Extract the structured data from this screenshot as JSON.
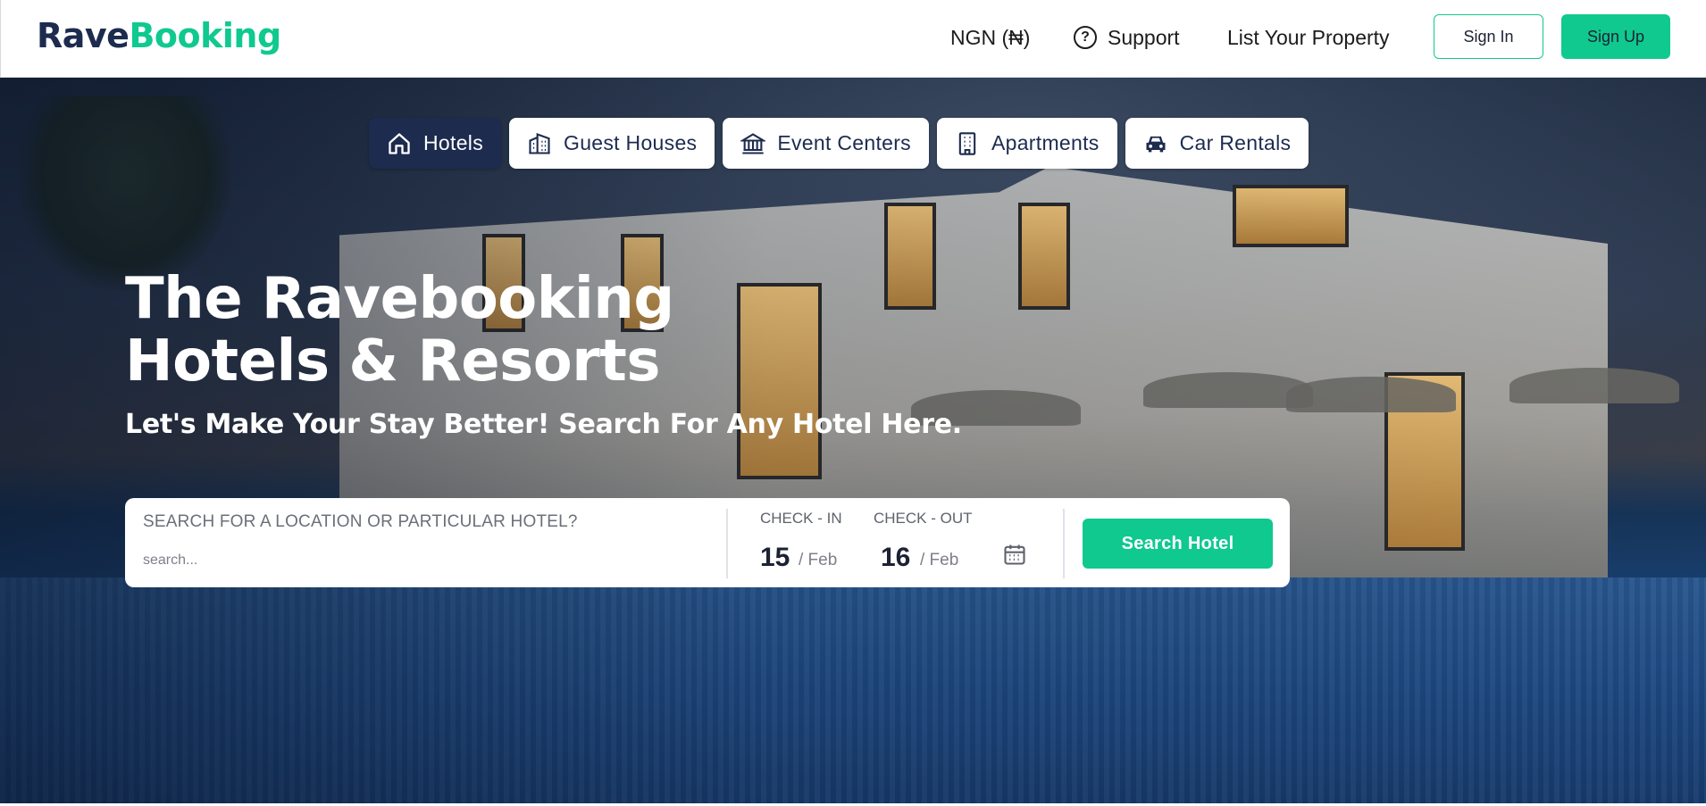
{
  "header": {
    "logo_part1": "Rave",
    "logo_part2": "Booking",
    "currency": "NGN (₦)",
    "support_label": "Support",
    "list_property_label": "List Your Property",
    "sign_in_label": "Sign In",
    "sign_up_label": "Sign Up"
  },
  "tabs": [
    {
      "label": "Hotels",
      "icon": "home-icon",
      "active": true
    },
    {
      "label": "Guest Houses",
      "icon": "building-icon",
      "active": false
    },
    {
      "label": "Event Centers",
      "icon": "bank-icon",
      "active": false
    },
    {
      "label": "Apartments",
      "icon": "apartment-icon",
      "active": false
    },
    {
      "label": "Car Rentals",
      "icon": "car-icon",
      "active": false
    }
  ],
  "hero": {
    "title_line1": "The Ravebooking",
    "title_line2": "Hotels & Resorts",
    "subtitle": "Let's Make Your Stay Better! Search For Any Hotel Here."
  },
  "search": {
    "label": "SEARCH FOR A LOCATION OR PARTICULAR HOTEL?",
    "placeholder": "search...",
    "check_in_label": "CHECK - IN",
    "check_in_day": "15",
    "check_in_month": "/ Feb",
    "check_out_label": "CHECK - OUT",
    "check_out_day": "16",
    "check_out_month": "/ Feb",
    "button_label": "Search Hotel"
  },
  "colors": {
    "brand_dark": "#1d2b4f",
    "brand_green": "#0fc98f"
  }
}
